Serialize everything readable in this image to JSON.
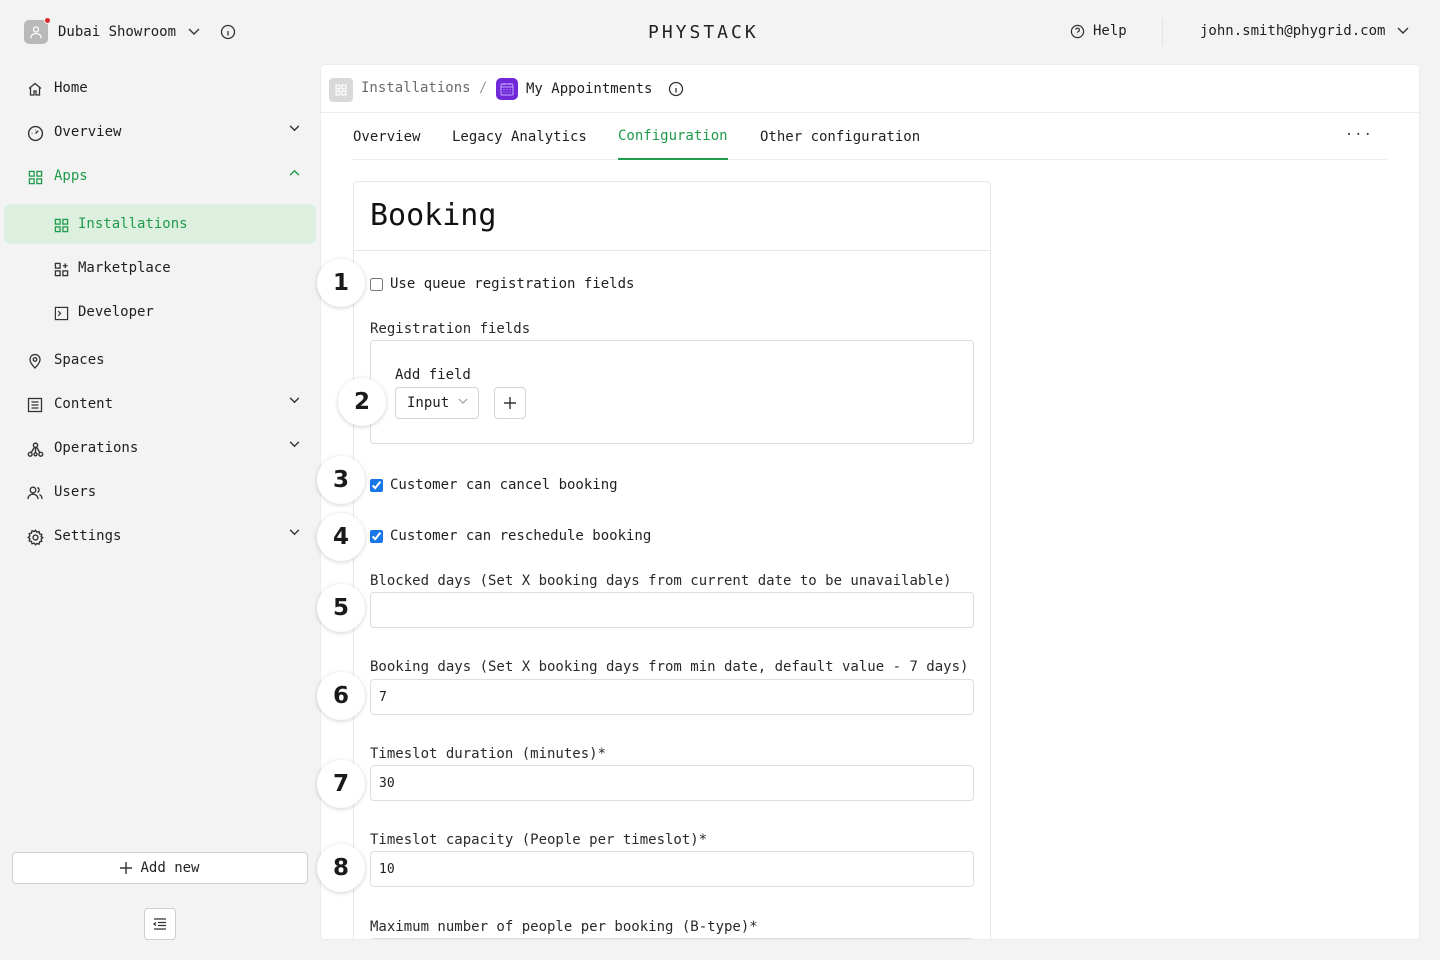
{
  "workspace": {
    "name": "Dubai Showroom"
  },
  "brand": {
    "logo_text": "PHYSTACK"
  },
  "header": {
    "help_label": "Help",
    "user_email": "john.smith@phygrid.com"
  },
  "sidebar": {
    "items": [
      {
        "label": "Home",
        "icon": "home-icon"
      },
      {
        "label": "Overview",
        "icon": "gauge-icon"
      },
      {
        "label": "Apps",
        "icon": "apps-grid-icon"
      },
      {
        "label": "Installations",
        "icon": "apps-grid-icon",
        "active": true
      },
      {
        "label": "Marketplace",
        "icon": "marketplace-icon"
      },
      {
        "label": "Developer",
        "icon": "terminal-icon"
      },
      {
        "label": "Spaces",
        "icon": "map-pin-icon"
      },
      {
        "label": "Content",
        "icon": "content-list-icon"
      },
      {
        "label": "Operations",
        "icon": "network-icon"
      },
      {
        "label": "Users",
        "icon": "users-icon"
      },
      {
        "label": "Settings",
        "icon": "gear-icon"
      }
    ],
    "add_new_label": "Add new"
  },
  "breadcrumb": {
    "parent": "Installations",
    "separator": "/",
    "current": "My Appointments"
  },
  "tabs": [
    {
      "label": "Overview"
    },
    {
      "label": "Legacy Analytics"
    },
    {
      "label": "Configuration",
      "active": true
    },
    {
      "label": "Other configuration"
    }
  ],
  "more_label": "···",
  "form": {
    "title": "Booking",
    "use_queue_fields": {
      "label": "Use queue registration fields",
      "checked": false
    },
    "registration_fields": {
      "label": "Registration fields",
      "add_field_label": "Add field",
      "type_value": "Input"
    },
    "cancel_booking": {
      "label": "Customer can cancel booking",
      "checked": true
    },
    "reschedule_booking": {
      "label": "Customer can reschedule booking",
      "checked": true
    },
    "blocked_days": {
      "label": "Blocked days (Set X booking days from current date to be unavailable)",
      "value": ""
    },
    "booking_days": {
      "label": "Booking days (Set X booking days from min date, default value - 7 days)",
      "value": "7"
    },
    "timeslot_duration": {
      "label": "Timeslot duration (minutes)*",
      "value": "30"
    },
    "timeslot_capacity": {
      "label": "Timeslot capacity (People per timeslot)*",
      "value": "10"
    },
    "max_people": {
      "label": "Maximum number of people per booking (B-type)*"
    }
  },
  "badges": [
    "1",
    "2",
    "3",
    "4",
    "5",
    "6",
    "7",
    "8"
  ],
  "colors": {
    "accent": "#1f9b4b",
    "active_bg": "#ddf0df",
    "app_icon": "#7028d8",
    "checkbox": "#1976e8",
    "notification": "#e0282e"
  }
}
